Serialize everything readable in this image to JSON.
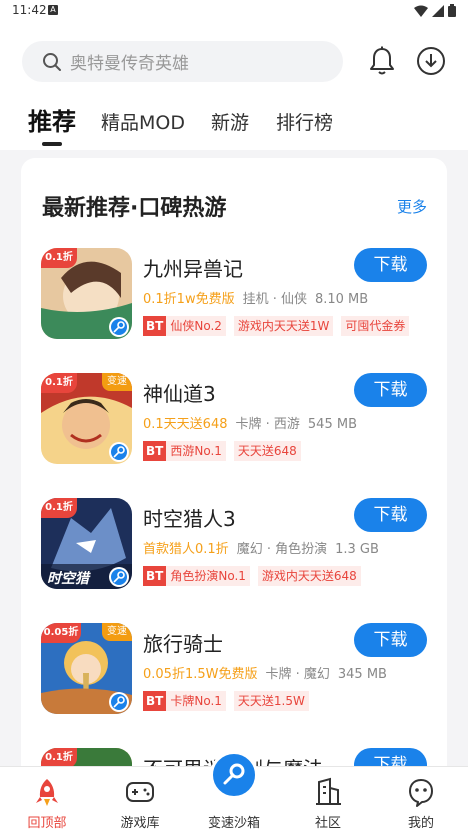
{
  "status": {
    "time": "11:42",
    "a_badge": "A"
  },
  "search": {
    "placeholder": "奥特曼传奇英雄"
  },
  "tabs": [
    {
      "label": "推荐"
    },
    {
      "label": "精品MOD"
    },
    {
      "label": "新游"
    },
    {
      "label": "排行榜"
    }
  ],
  "section": {
    "title": "最新推荐·口碑热游",
    "more": "更多"
  },
  "games": [
    {
      "name": "九州异兽记",
      "promo": "0.1折1w免费版",
      "category": "挂机 · 仙侠",
      "size": "8.10 MB",
      "download": "下载",
      "tags": [
        {
          "bt": "BT",
          "text": "仙侠No.2"
        },
        {
          "text": "游戏内天天送1W"
        },
        {
          "text": "可囤代金券"
        }
      ],
      "badge": "0.1折",
      "icon_colors": [
        "#8a5a3a",
        "#e7c8a0"
      ]
    },
    {
      "name": "神仙道3",
      "promo": "0.1天天送648",
      "category": "卡牌 · 西游",
      "size": "545 MB",
      "download": "下载",
      "tags": [
        {
          "bt": "BT",
          "text": "西游No.1"
        },
        {
          "text": "天天送648"
        }
      ],
      "badge": "0.1折",
      "corner": "变速",
      "icon_colors": [
        "#c0392b",
        "#f5d38a"
      ]
    },
    {
      "name": "时空猎人3",
      "promo": "首款猎人0.1折",
      "category": "魔幻 · 角色扮演",
      "size": "1.3 GB",
      "download": "下载",
      "tags": [
        {
          "bt": "BT",
          "text": "角色扮演No.1"
        },
        {
          "text": "游戏内天天送648"
        }
      ],
      "badge": "0.1折",
      "icon_text": "时空猎",
      "icon_colors": [
        "#1d2f5a",
        "#6c8fc8"
      ]
    },
    {
      "name": "旅行骑士",
      "promo": "0.05折1.5W免费版",
      "category": "卡牌 · 魔幻",
      "size": "345 MB",
      "download": "下载",
      "tags": [
        {
          "bt": "BT",
          "text": "卡牌No.1"
        },
        {
          "text": "天天送1.5W"
        }
      ],
      "badge": "0.05折",
      "corner": "变速",
      "icon_colors": [
        "#2d6fc0",
        "#f2c25a"
      ]
    },
    {
      "name": "不可思议之剑与魔法",
      "download": "下载",
      "badge": "0.1折",
      "icon_colors": [
        "#3a7a3a",
        "#e8c070"
      ]
    }
  ],
  "nav": [
    {
      "label": "回顶部",
      "icon": "rocket-icon",
      "active": true
    },
    {
      "label": "游戏库",
      "icon": "gamepad-icon"
    },
    {
      "label": "变速沙箱",
      "icon": "key-icon"
    },
    {
      "label": "社区",
      "icon": "building-icon"
    },
    {
      "label": "我的",
      "icon": "face-icon"
    }
  ],
  "colors": {
    "accent": "#1a82ea",
    "promo": "#f5a01a",
    "tag": "#e8453c"
  }
}
